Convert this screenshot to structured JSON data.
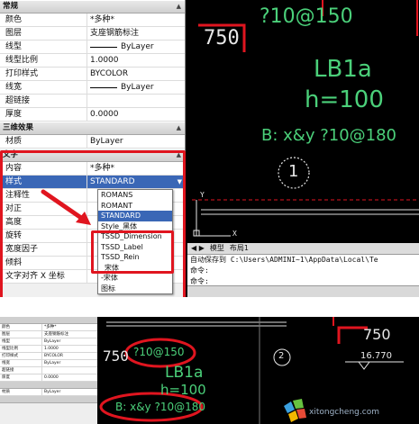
{
  "properties": {
    "sections": {
      "general": "常规",
      "threed": "三维效果",
      "text": "文字"
    },
    "general_rows": [
      {
        "label": "颜色",
        "value": "*多种*"
      },
      {
        "label": "图层",
        "value": "支座钢筋标注"
      },
      {
        "label": "线型",
        "value": "ByLayer"
      },
      {
        "label": "线型比例",
        "value": "1.0000"
      },
      {
        "label": "打印样式",
        "value": "BYCOLOR"
      },
      {
        "label": "线宽",
        "value": "ByLayer"
      },
      {
        "label": "超链接",
        "value": ""
      },
      {
        "label": "厚度",
        "value": "0.0000"
      }
    ],
    "threed_rows": [
      {
        "label": "材质",
        "value": "ByLayer"
      }
    ],
    "text_rows": [
      {
        "label": "内容",
        "value": "*多种*"
      },
      {
        "label": "样式",
        "value": "STANDARD"
      },
      {
        "label": "注释性",
        "value": ""
      },
      {
        "label": "对正",
        "value": ""
      },
      {
        "label": "高度",
        "value": ""
      },
      {
        "label": "旋转",
        "value": ""
      },
      {
        "label": "宽度因子",
        "value": ""
      },
      {
        "label": "倾斜",
        "value": ""
      },
      {
        "label": "文字对齐 X 坐标",
        "value": ""
      }
    ],
    "style_dropdown": {
      "options": [
        "ROMANS",
        "ROMANT",
        "STANDARD",
        "Style_黑体",
        "TSSD_Dimension",
        "TSSD_Label",
        "TSSD_Rein",
        "_宋体",
        "-宋体",
        "图标"
      ],
      "selected": "STANDARD"
    }
  },
  "drawing_top": {
    "dim_750": "750",
    "rebar_text": "?10@150",
    "slab_label": "LB1a",
    "slab_height": "h=100",
    "bottom_rebar": "B: x&y ?10@180",
    "axis_circle": "1",
    "ucs_y": "Y",
    "ucs_x": "X"
  },
  "command": {
    "tabs": [
      "模型",
      "布局1"
    ],
    "lines": [
      "自动保存到 C:\\Users\\ADMINI~1\\AppData\\Local\\Te",
      "命令:",
      "命令:"
    ]
  },
  "bottom_props": {
    "rows": [
      {
        "label": "颜色",
        "value": "*多种*"
      },
      {
        "label": "图层",
        "value": "支座钢筋标注"
      },
      {
        "label": "线型",
        "value": "ByLayer"
      },
      {
        "label": "线型比例",
        "value": "1.0000"
      },
      {
        "label": "打印样式",
        "value": "BYCOLOR"
      },
      {
        "label": "线宽",
        "value": "ByLayer"
      },
      {
        "label": "超链接",
        "value": ""
      },
      {
        "label": "厚度",
        "value": "0.0000"
      }
    ],
    "tail_rows": [
      {
        "label": "材质",
        "value": "ByLayer"
      }
    ]
  },
  "drawing_bottom": {
    "dim_750_left": "750",
    "rebar_text": "?10@150",
    "slab_label": "LB1a",
    "slab_height": "h=100",
    "bottom_rebar": "B: x&y ?10@180",
    "axis_circle": "2",
    "dim_750_right": "750",
    "level": "16.770"
  },
  "watermark": "xitongcheng.com",
  "colors": {
    "highlight_red": "#e0151f",
    "selection_blue": "#3a67b6",
    "cad_green": "#4bd07a"
  }
}
